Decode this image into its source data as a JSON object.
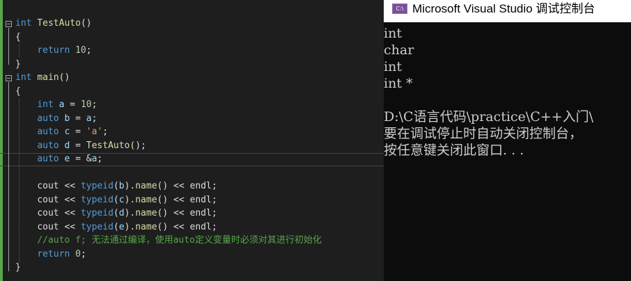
{
  "editor": {
    "lines": [
      {
        "segments": [
          {
            "t": "int",
            "c": "kw"
          },
          {
            "t": " ",
            "c": "plain"
          },
          {
            "t": "TestAuto",
            "c": "fn"
          },
          {
            "t": "()",
            "c": "plain"
          }
        ]
      },
      {
        "segments": [
          {
            "t": "{",
            "c": "plain"
          }
        ]
      },
      {
        "segments": [
          {
            "t": "    ",
            "c": "plain"
          },
          {
            "t": "return",
            "c": "kw"
          },
          {
            "t": " ",
            "c": "plain"
          },
          {
            "t": "10",
            "c": "num"
          },
          {
            "t": ";",
            "c": "plain"
          }
        ]
      },
      {
        "segments": [
          {
            "t": "}",
            "c": "plain"
          }
        ]
      },
      {
        "segments": [
          {
            "t": "int",
            "c": "kw"
          },
          {
            "t": " ",
            "c": "plain"
          },
          {
            "t": "main",
            "c": "fn"
          },
          {
            "t": "()",
            "c": "plain"
          }
        ]
      },
      {
        "segments": [
          {
            "t": "{",
            "c": "plain"
          }
        ]
      },
      {
        "segments": [
          {
            "t": "    ",
            "c": "plain"
          },
          {
            "t": "int",
            "c": "kw"
          },
          {
            "t": " ",
            "c": "plain"
          },
          {
            "t": "a",
            "c": "var"
          },
          {
            "t": " = ",
            "c": "plain"
          },
          {
            "t": "10",
            "c": "num"
          },
          {
            "t": ";",
            "c": "plain"
          }
        ]
      },
      {
        "segments": [
          {
            "t": "    ",
            "c": "plain"
          },
          {
            "t": "auto",
            "c": "kw"
          },
          {
            "t": " ",
            "c": "plain"
          },
          {
            "t": "b",
            "c": "var"
          },
          {
            "t": " = ",
            "c": "plain"
          },
          {
            "t": "a",
            "c": "var"
          },
          {
            "t": ";",
            "c": "plain"
          }
        ]
      },
      {
        "segments": [
          {
            "t": "    ",
            "c": "plain"
          },
          {
            "t": "auto",
            "c": "kw"
          },
          {
            "t": " ",
            "c": "plain"
          },
          {
            "t": "c",
            "c": "var"
          },
          {
            "t": " = ",
            "c": "plain"
          },
          {
            "t": "'a'",
            "c": "str"
          },
          {
            "t": ";",
            "c": "plain"
          }
        ]
      },
      {
        "segments": [
          {
            "t": "    ",
            "c": "plain"
          },
          {
            "t": "auto",
            "c": "kw"
          },
          {
            "t": " ",
            "c": "plain"
          },
          {
            "t": "d",
            "c": "var"
          },
          {
            "t": " = ",
            "c": "plain"
          },
          {
            "t": "TestAuto",
            "c": "fn"
          },
          {
            "t": "();",
            "c": "plain"
          }
        ]
      },
      {
        "segments": [
          {
            "t": "    ",
            "c": "plain"
          },
          {
            "t": "auto",
            "c": "kw"
          },
          {
            "t": " ",
            "c": "plain"
          },
          {
            "t": "e",
            "c": "var"
          },
          {
            "t": " = &",
            "c": "plain"
          },
          {
            "t": "a",
            "c": "var"
          },
          {
            "t": ";",
            "c": "plain"
          }
        ]
      },
      {
        "segments": []
      },
      {
        "segments": [
          {
            "t": "    ",
            "c": "plain"
          },
          {
            "t": "cout",
            "c": "plain"
          },
          {
            "t": " << ",
            "c": "plain"
          },
          {
            "t": "typeid",
            "c": "kw"
          },
          {
            "t": "(",
            "c": "plain"
          },
          {
            "t": "b",
            "c": "var"
          },
          {
            "t": ").",
            "c": "plain"
          },
          {
            "t": "name",
            "c": "fn"
          },
          {
            "t": "() << ",
            "c": "plain"
          },
          {
            "t": "endl",
            "c": "plain"
          },
          {
            "t": ";",
            "c": "plain"
          }
        ]
      },
      {
        "segments": [
          {
            "t": "    ",
            "c": "plain"
          },
          {
            "t": "cout",
            "c": "plain"
          },
          {
            "t": " << ",
            "c": "plain"
          },
          {
            "t": "typeid",
            "c": "kw"
          },
          {
            "t": "(",
            "c": "plain"
          },
          {
            "t": "c",
            "c": "var"
          },
          {
            "t": ").",
            "c": "plain"
          },
          {
            "t": "name",
            "c": "fn"
          },
          {
            "t": "() << ",
            "c": "plain"
          },
          {
            "t": "endl",
            "c": "plain"
          },
          {
            "t": ";",
            "c": "plain"
          }
        ]
      },
      {
        "segments": [
          {
            "t": "    ",
            "c": "plain"
          },
          {
            "t": "cout",
            "c": "plain"
          },
          {
            "t": " << ",
            "c": "plain"
          },
          {
            "t": "typeid",
            "c": "kw"
          },
          {
            "t": "(",
            "c": "plain"
          },
          {
            "t": "d",
            "c": "var"
          },
          {
            "t": ").",
            "c": "plain"
          },
          {
            "t": "name",
            "c": "fn"
          },
          {
            "t": "() << ",
            "c": "plain"
          },
          {
            "t": "endl",
            "c": "plain"
          },
          {
            "t": ";",
            "c": "plain"
          }
        ]
      },
      {
        "segments": [
          {
            "t": "    ",
            "c": "plain"
          },
          {
            "t": "cout",
            "c": "plain"
          },
          {
            "t": " << ",
            "c": "plain"
          },
          {
            "t": "typeid",
            "c": "kw"
          },
          {
            "t": "(",
            "c": "plain"
          },
          {
            "t": "e",
            "c": "var"
          },
          {
            "t": ").",
            "c": "plain"
          },
          {
            "t": "name",
            "c": "fn"
          },
          {
            "t": "() << ",
            "c": "plain"
          },
          {
            "t": "endl",
            "c": "plain"
          },
          {
            "t": ";",
            "c": "plain"
          }
        ]
      },
      {
        "segments": [
          {
            "t": "    ",
            "c": "plain"
          },
          {
            "t": "//auto f; 无法通过编译，使用auto定义变量时必须对其进行初始化",
            "c": "cmt"
          }
        ]
      },
      {
        "segments": [
          {
            "t": "    ",
            "c": "plain"
          },
          {
            "t": "return",
            "c": "kw"
          },
          {
            "t": " ",
            "c": "plain"
          },
          {
            "t": "0",
            "c": "num"
          },
          {
            "t": ";",
            "c": "plain"
          }
        ]
      },
      {
        "segments": [
          {
            "t": "}",
            "c": "plain"
          }
        ]
      }
    ]
  },
  "console": {
    "title": "Microsoft Visual Studio 调试控制台",
    "icon_label": "C:\\",
    "output": [
      "int",
      "char",
      "int",
      "int *",
      "",
      "D:\\C语言代码\\practice\\C++入门\\",
      "要在调试停止时自动关闭控制台，",
      "按任意键关闭此窗口. . ."
    ]
  },
  "colors": {
    "keyword": "#569cd6",
    "function": "#dcdcaa",
    "number": "#b5cea8",
    "string": "#d69d85",
    "variable": "#9cdcfe",
    "comment": "#57a64a",
    "text": "#dcdcdc",
    "editor_bg": "#1e1e1e",
    "console_bg": "#0c0c0c"
  }
}
